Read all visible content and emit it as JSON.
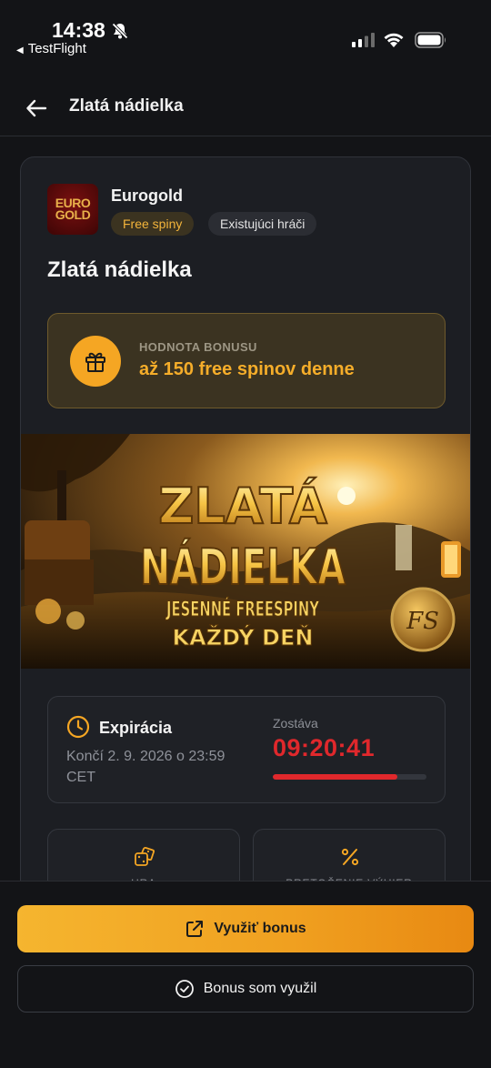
{
  "status_bar": {
    "time": "14:38",
    "back_app": "TestFlight"
  },
  "nav": {
    "title": "Zlatá nádielka"
  },
  "offer": {
    "logo_text_line1": "EURO",
    "logo_text_line2": "GOLD",
    "brand": "Eurogold",
    "badges": [
      "Free spiny",
      "Existujúci hráči"
    ],
    "title": "Zlatá nádielka",
    "bonus_label": "HODNOTA BONUSU",
    "bonus_value": "až 150 free spinov denne",
    "banner": {
      "line1": "ZLATÁ",
      "line2": "NÁDIELKA",
      "line3": "JESENNÉ FREESPINY",
      "line4": "KAŽDÝ DEŇ",
      "coin_text": "FS"
    },
    "expiry": {
      "title": "Expirácia",
      "date": "Končí 2. 9. 2026 o 23:59 CET",
      "remaining_label": "Zostáva",
      "remaining_time": "09:20:41",
      "remaining_fraction": 0.81
    },
    "details": [
      {
        "label": "HRA",
        "icon": "dice-icon"
      },
      {
        "label": "PRETOČENIE VÝHIER",
        "icon": "percent-icon"
      }
    ]
  },
  "actions": {
    "primary": "Využiť bonus",
    "secondary": "Bonus som využil"
  },
  "colors": {
    "accent": "#f5a623",
    "danger": "#e0282c",
    "background": "#131417",
    "card": "#1c1e23"
  }
}
